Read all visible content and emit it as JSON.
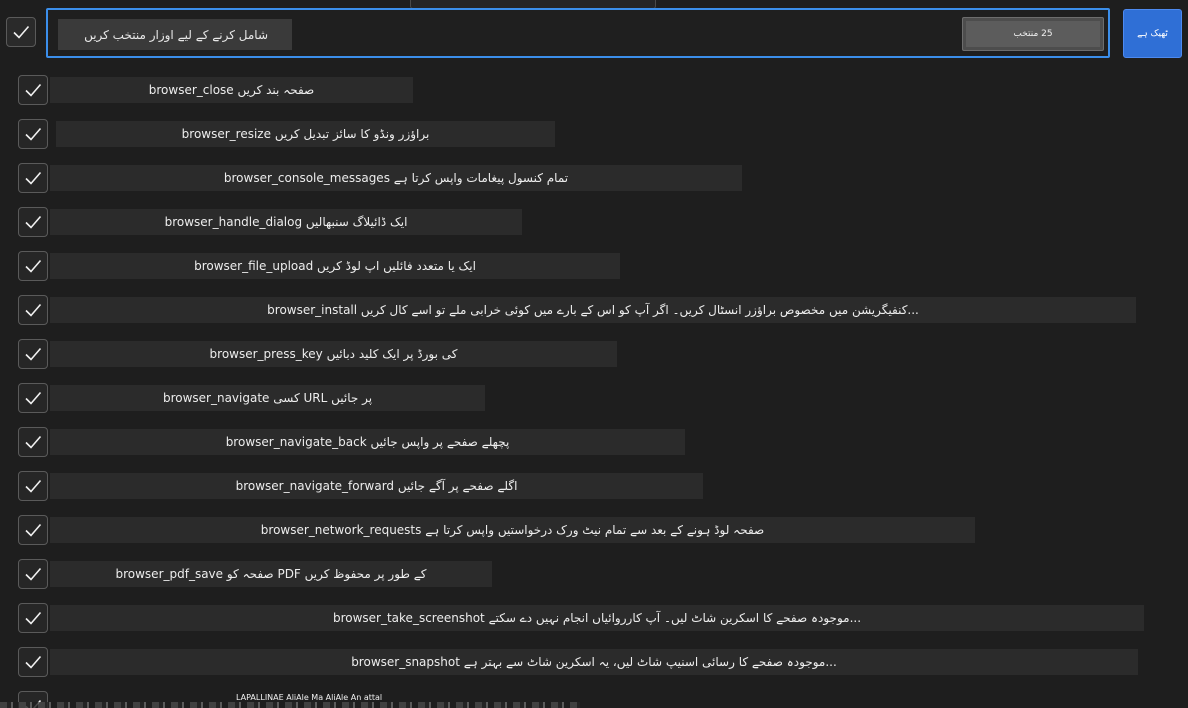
{
  "header": {
    "select_all_checked": true,
    "search_placeholder": "شامل کرنے کے لیے اوزار منتخب کریں",
    "selected_count": "25 منتخب",
    "ok_label": "ٹھیک ہے"
  },
  "tools": [
    {
      "label": "صفحہ بند کریں browser_close",
      "checked": true
    },
    {
      "label": "براؤزر ونڈو کا سائز تبدیل کریں browser_resize",
      "checked": true
    },
    {
      "label": "تمام کنسول پیغامات واپس کرتا ہے browser_console_messages",
      "checked": true
    },
    {
      "label": "ایک ڈائیلاگ سنبھالیں browser_handle_dialog",
      "checked": true
    },
    {
      "label": "ایک یا متعدد فائلیں اپ لوڈ کریں browser_file_upload",
      "checked": true
    },
    {
      "label": "...کنفیگریشن میں مخصوص براؤزر انسٹال کریں۔ اگر آپ کو اس کے بارے میں کوئی خرابی ملے تو اسے کال کریں browser_install",
      "checked": true
    },
    {
      "label": "کی بورڈ پر ایک کلید دبائیں browser_press_key",
      "checked": true
    },
    {
      "label": "پر جائیں URL کسی browser_navigate",
      "checked": true
    },
    {
      "label": "پچھلے صفحے پر واپس جائیں browser_navigate_back",
      "checked": true
    },
    {
      "label": "اگلے صفحے پر آگے جائیں browser_navigate_forward",
      "checked": true
    },
    {
      "label": "صفحہ لوڈ ہونے کے بعد سے تمام نیٹ ورک درخواستیں واپس کرتا ہے browser_network_requests",
      "checked": true
    },
    {
      "label": "کے طور پر محفوظ کریں PDF صفحہ کو browser_pdf_save",
      "checked": true
    },
    {
      "label": "...موجودہ صفحے کا اسکرین شاٹ لیں۔ آپ کارروائیاں انجام نہیں دے سکتے browser_take_screenshot",
      "checked": true
    },
    {
      "label": "...موجودہ صفحے کا رسائی اسنیپ شاٹ لیں، یہ اسکرین شاٹ سے بہتر ہے browser_snapshot",
      "checked": true
    }
  ],
  "partial_row_text": "LAPALLINAE AliAle Ma        AliAle An attal",
  "colors": {
    "accent": "#3b8eea",
    "ok_button": "#2f6fd6",
    "background": "#1e1e1e",
    "row_bg": "#2b2b2b"
  }
}
